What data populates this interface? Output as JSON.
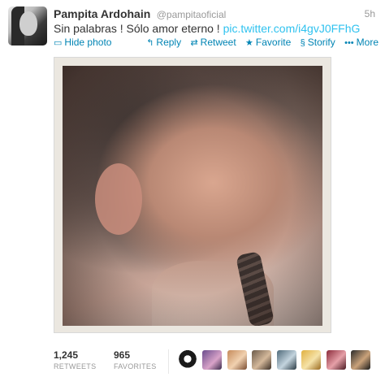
{
  "tweet": {
    "fullname": "Pampita Ardohain",
    "username": "@pampitaoficial",
    "time": "5h",
    "text": "Sin palabras ! Sólo amor eterno ! ",
    "link": "pic.twitter.com/i4gvJ0FFhG"
  },
  "actions": {
    "hide_photo": "Hide photo",
    "reply": "Reply",
    "retweet": "Retweet",
    "favorite": "Favorite",
    "storify": "Storify",
    "more": "More"
  },
  "stats": {
    "retweets_count": "1,245",
    "retweets_label": "RETWEETS",
    "favorites_count": "965",
    "favorites_label": "FAVORITES"
  },
  "colors": {
    "link": "#2fc2ef",
    "action": "#0084b4",
    "muted": "#999999",
    "text": "#333333"
  },
  "icons": {
    "hide_photo": "photo-icon",
    "reply": "reply-arrow-icon",
    "retweet": "retweet-icon",
    "favorite": "star-icon",
    "storify": "storify-icon",
    "more": "ellipsis-icon"
  }
}
